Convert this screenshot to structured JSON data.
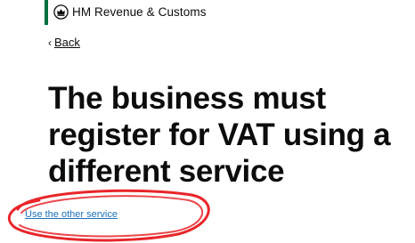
{
  "header": {
    "brand_name": "HM Revenue & Customs",
    "crest_icon": "crown-crest-icon",
    "accent_color": "#00703c"
  },
  "navigation": {
    "back_label": "Back",
    "back_icon": "chevron-left-icon"
  },
  "main": {
    "title": "The business must register for VAT using a different service",
    "link_label": "Use the other service",
    "link_color": "#1d70b8"
  },
  "annotation": {
    "type": "red-ellipse",
    "color": "#e8262a"
  }
}
